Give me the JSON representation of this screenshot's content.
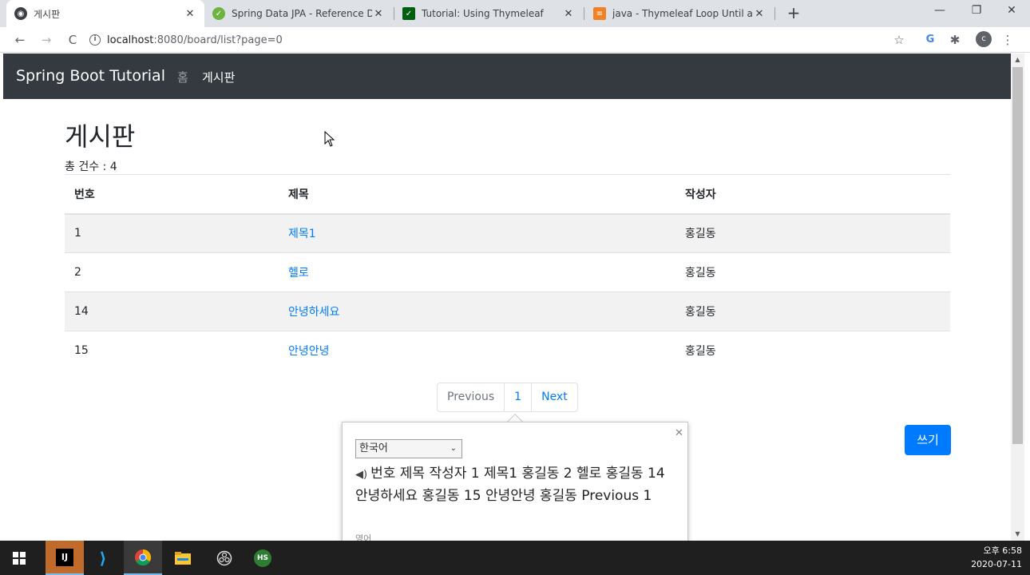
{
  "browser": {
    "tabs": [
      {
        "title": "게시판",
        "favicon": "globe-icon",
        "active": true
      },
      {
        "title": "Spring Data JPA - Reference Do",
        "favicon": "spring-leaf-icon",
        "active": false
      },
      {
        "title": "Tutorial: Using Thymeleaf",
        "favicon": "thymeleaf-icon",
        "active": false
      },
      {
        "title": "java - Thymeleaf Loop Until a N",
        "favicon": "stackoverflow-icon",
        "active": false
      }
    ],
    "url_host": "localhost",
    "url_path": ":8080/board/list?page=0",
    "profile_initial": "c"
  },
  "navbar": {
    "brand": "Spring Boot Tutorial",
    "links": [
      {
        "label": "홈",
        "active": false
      },
      {
        "label": "게시판",
        "active": true
      }
    ]
  },
  "board": {
    "title": "게시판",
    "total_label": "총 건수 : 4",
    "columns": [
      "번호",
      "제목",
      "작성자"
    ],
    "rows": [
      {
        "no": "1",
        "title": "제목1",
        "author": "홍길동"
      },
      {
        "no": "2",
        "title": "헬로",
        "author": "홍길동"
      },
      {
        "no": "14",
        "title": "안녕하세요",
        "author": "홍길동"
      },
      {
        "no": "15",
        "title": "안녕안녕",
        "author": "홍길동"
      }
    ],
    "pagination": {
      "previous": "Previous",
      "current": "1",
      "next": "Next"
    },
    "write_button": "쓰기"
  },
  "translate_popup": {
    "language": "한국어",
    "text": "번호 제목 작성자 1 제목1 홍길동 2 헬로 홍길동 14 안녕하세요 홍길동 15 안녕안녕 홍길동 Previous 1",
    "source_language": "영어"
  },
  "taskbar": {
    "apps": [
      "windows-start-icon",
      "intellij-icon",
      "vscode-icon",
      "chrome-icon",
      "file-explorer-icon",
      "obs-icon",
      "heidisql-icon"
    ],
    "time": "오후 6:58",
    "date": "2020-07-11"
  },
  "colors": {
    "navbar_bg": "#343a40",
    "link": "#007bff",
    "button_primary": "#007bff",
    "stripe": "#f2f2f2"
  }
}
